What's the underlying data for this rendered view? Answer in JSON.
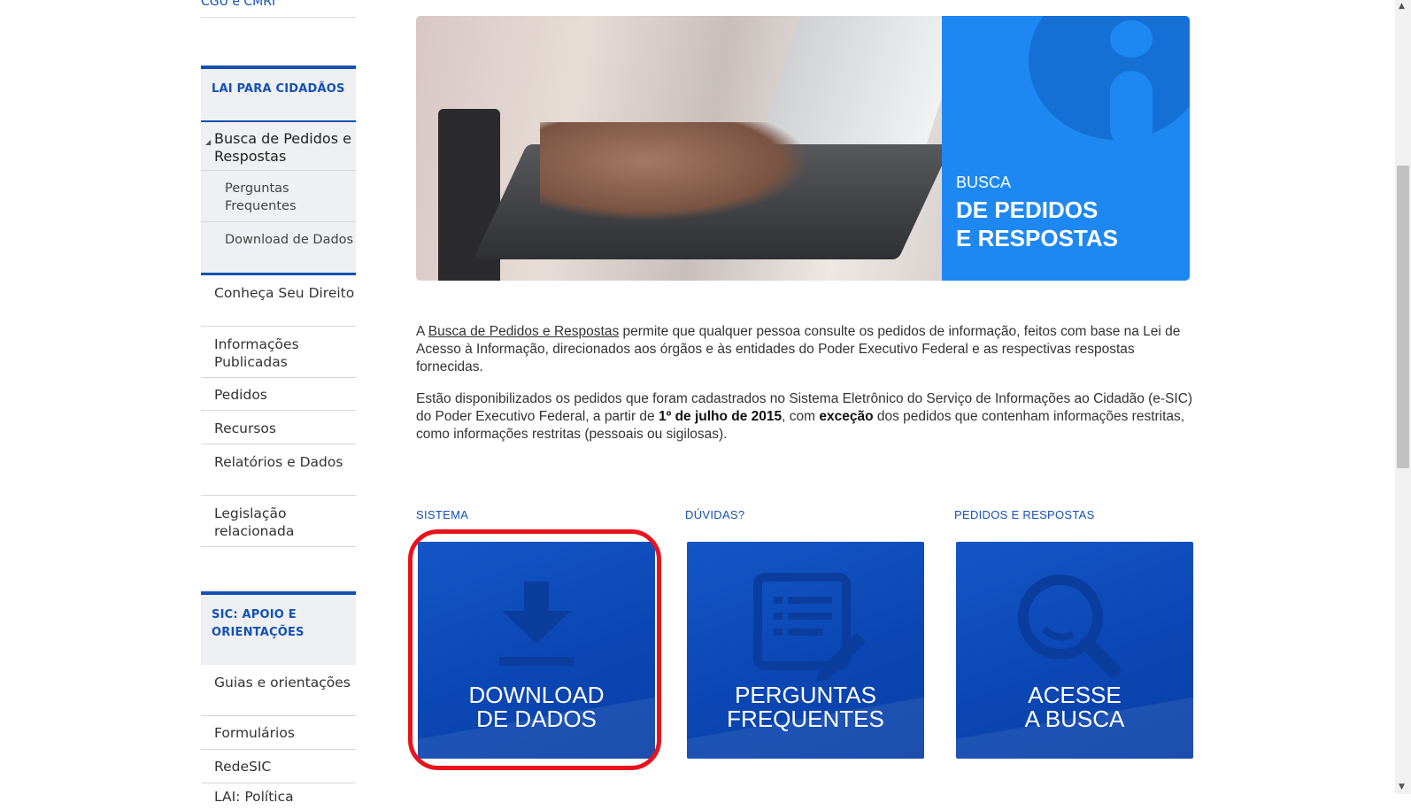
{
  "sidebar": {
    "top_link": "CGU e CMRI",
    "section1_title": "LAI PARA CIDADÃOS",
    "active_item": "Busca de Pedidos e Respostas",
    "sub_items": [
      "Perguntas Frequentes",
      "Download de Dados"
    ],
    "items": [
      "Conheça Seu Direito",
      "Informações Publicadas",
      "Pedidos",
      "Recursos",
      "Relatórios e Dados",
      "Legislação relacionada"
    ],
    "section2_title": "SIC: APOIO E ORIENTAÇÕES",
    "items2": [
      "Guias e orientações",
      "Formulários",
      "RedeSIC",
      "LAI: Política"
    ]
  },
  "hero": {
    "small": "BUSCA",
    "big_line1": "DE PEDIDOS",
    "big_line2": "E RESPOSTAS"
  },
  "intro": {
    "p1_a": "A ",
    "p1_link": "Busca de Pedidos e Respostas",
    "p1_b": " permite que qualquer pessoa consulte os pedidos de informação, feitos com base na Lei de Acesso à Informação, direcionados aos órgãos e às entidades do Poder Executivo Federal e as respectivas respostas fornecidas.",
    "p2_a": "Estão disponibilizados os pedidos que foram cadastrados no Sistema Eletrônico do Serviço de Informações ao Cidadão (e-SIC) do Poder Executivo Federal, a partir de ",
    "p2_bold1": "1º de julho de 2015",
    "p2_b": ", com ",
    "p2_bold2": "exceção",
    "p2_c": " dos pedidos que contenham informações restritas, como informações restritas (pessoais ou sigilosas)."
  },
  "cards": [
    {
      "label": "SISTEMA",
      "line1": "DOWNLOAD",
      "line2": "DE DADOS",
      "icon": "download-icon"
    },
    {
      "label": "DÚVIDAS?",
      "line1": "PERGUNTAS",
      "line2": "FREQUENTES",
      "icon": "document-edit-icon"
    },
    {
      "label": "PEDIDOS E RESPOSTAS",
      "line1": "ACESSE",
      "line2": "A BUSCA",
      "icon": "magnifier-icon"
    }
  ],
  "colors": {
    "accent": "#1351b4",
    "card_blue": "#0b47b4",
    "hero_blue": "#1e88f2",
    "highlight": "#e8141c"
  }
}
